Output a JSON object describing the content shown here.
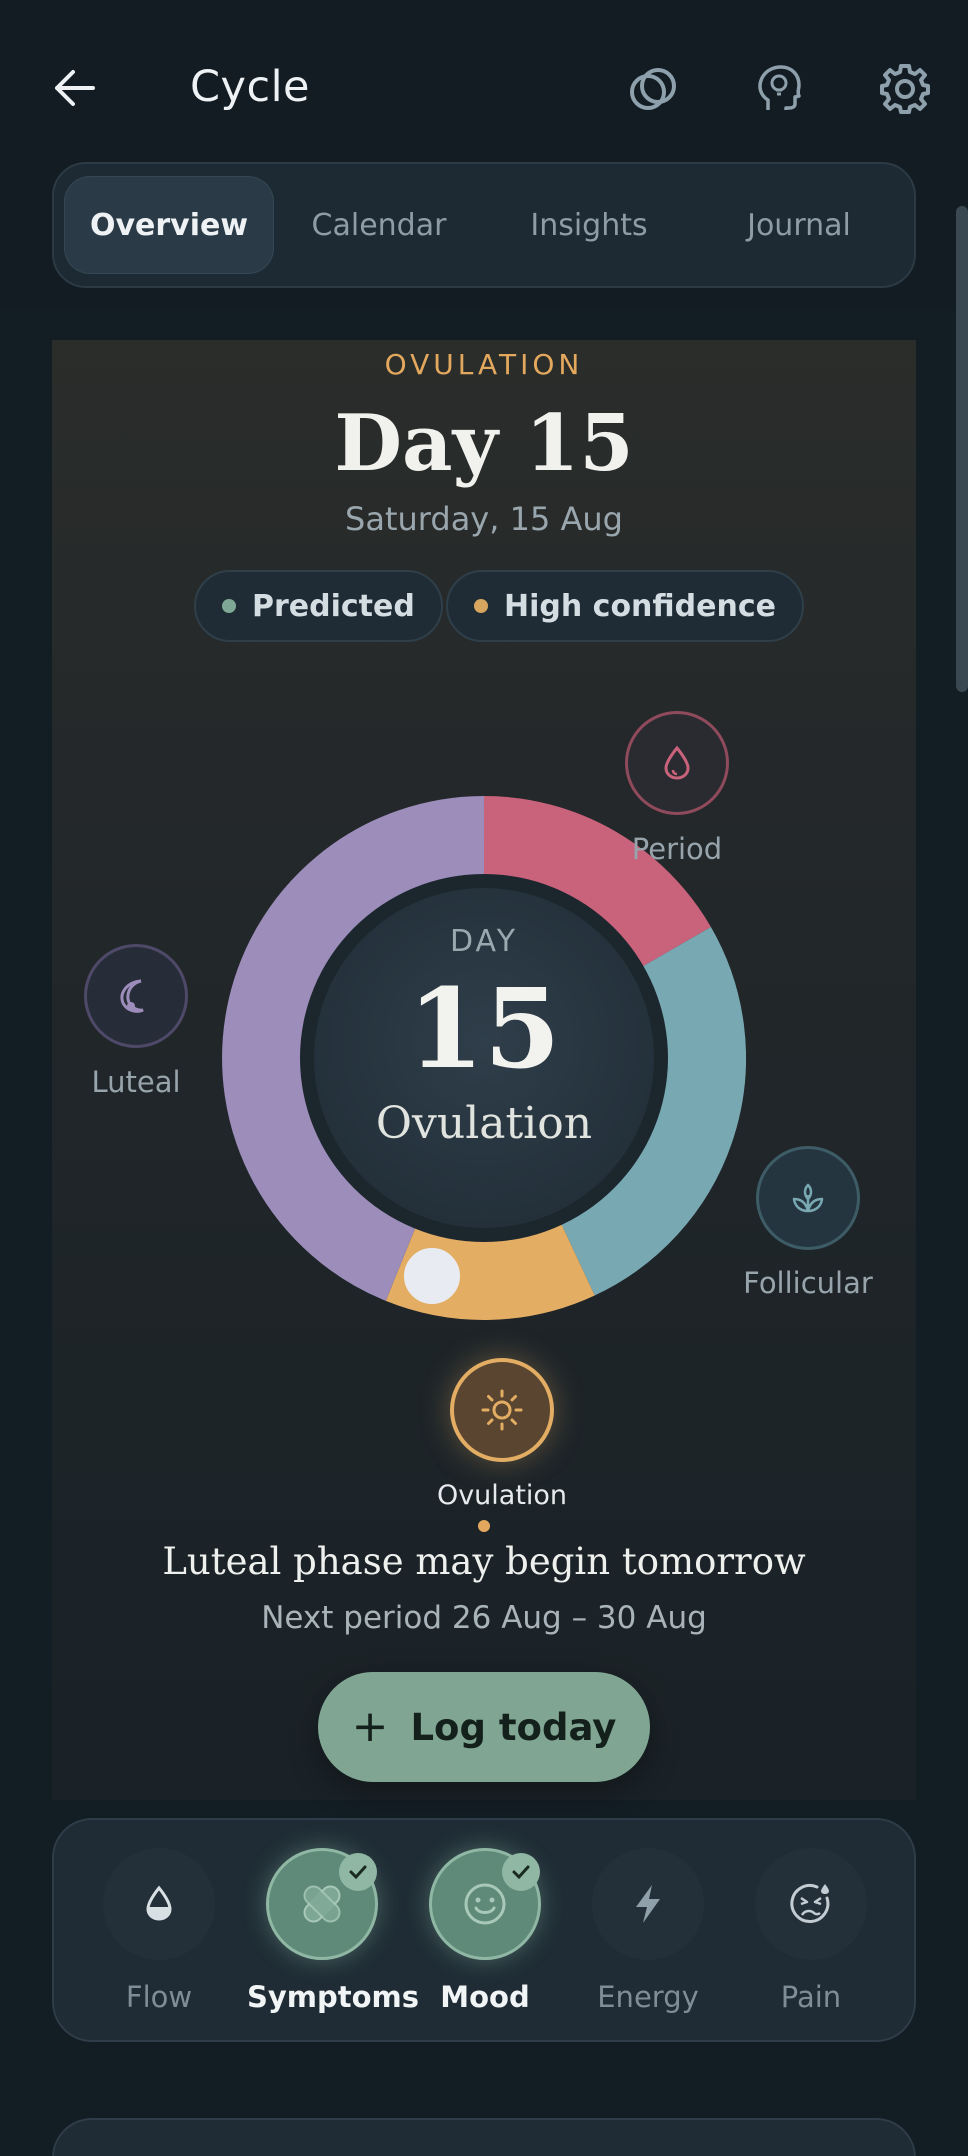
{
  "header": {
    "title": "Cycle",
    "icons": [
      "back-arrow-icon",
      "rings-icon",
      "head-bulb-icon",
      "gear-icon"
    ]
  },
  "tabs": [
    {
      "label": "Overview",
      "active": true
    },
    {
      "label": "Calendar",
      "active": false
    },
    {
      "label": "Insights",
      "active": false
    },
    {
      "label": "Journal",
      "active": false
    }
  ],
  "hero": {
    "phase": "OVULATION",
    "day_title": "Day 15",
    "date": "Saturday, 15 Aug",
    "pills": [
      {
        "label": "Predicted",
        "dot_color": "#7fa996"
      },
      {
        "label": "High confidence",
        "dot_color": "#d6a660"
      }
    ]
  },
  "ring": {
    "center_caption": "DAY",
    "center_day": "15",
    "center_phase": "Ovulation",
    "segments": [
      {
        "phase": "Period",
        "color": "#c9627b"
      },
      {
        "phase": "Follicular",
        "color": "#78a9b3"
      },
      {
        "phase": "Ovulation",
        "color": "#e3ad63"
      },
      {
        "phase": "Luteal",
        "color": "#9c8dba"
      }
    ],
    "nodes": [
      {
        "label": "Period",
        "icon": "drop-icon"
      },
      {
        "label": "Luteal",
        "icon": "moon-icon"
      },
      {
        "label": "Follicular",
        "icon": "sprout-icon"
      },
      {
        "label": "Ovulation",
        "icon": "sun-icon"
      }
    ]
  },
  "summary": {
    "headline": "Luteal phase may begin tomorrow",
    "next_period": "Next period 26 Aug – 30 Aug"
  },
  "log_button": {
    "label": "Log today"
  },
  "quick_log": [
    {
      "label": "Flow",
      "icon": "drop-half-icon",
      "active": false
    },
    {
      "label": "Symptoms",
      "icon": "bandage-icon",
      "active": true
    },
    {
      "label": "Mood",
      "icon": "smile-icon",
      "active": true
    },
    {
      "label": "Energy",
      "icon": "bolt-icon",
      "active": false
    },
    {
      "label": "Pain",
      "icon": "pain-face-icon",
      "active": false
    }
  ],
  "colors": {
    "accent": "#e3a85e",
    "primary_button": "#80a693",
    "background": "#131d24"
  }
}
